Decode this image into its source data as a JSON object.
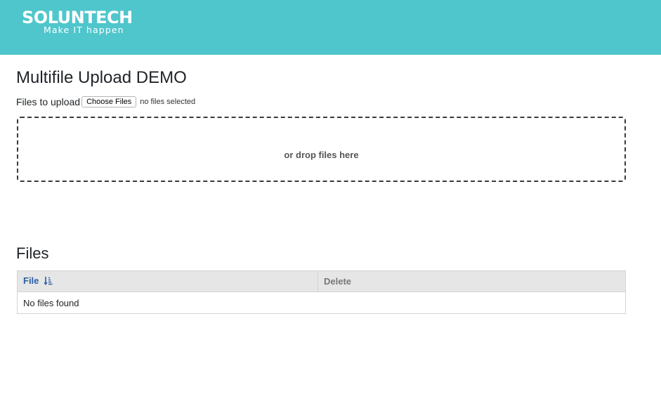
{
  "header": {
    "logo_text": "SOLUNTECH",
    "logo_tagline": "Make IT happen",
    "background_color": "#4fc6cc"
  },
  "page": {
    "title": "Multifile Upload DEMO"
  },
  "upload": {
    "label": "Files to upload",
    "choose_button_label": "Choose Files",
    "selected_status": "no files selected",
    "dropzone_text": "or drop files here"
  },
  "files_section": {
    "title": "Files",
    "columns": [
      {
        "label": "File",
        "icon": "sort-ascending-icon",
        "sortable": true
      },
      {
        "label": "Delete",
        "sortable": false
      }
    ],
    "empty_message": "No files found",
    "header_link_color": "#2c5da6"
  }
}
